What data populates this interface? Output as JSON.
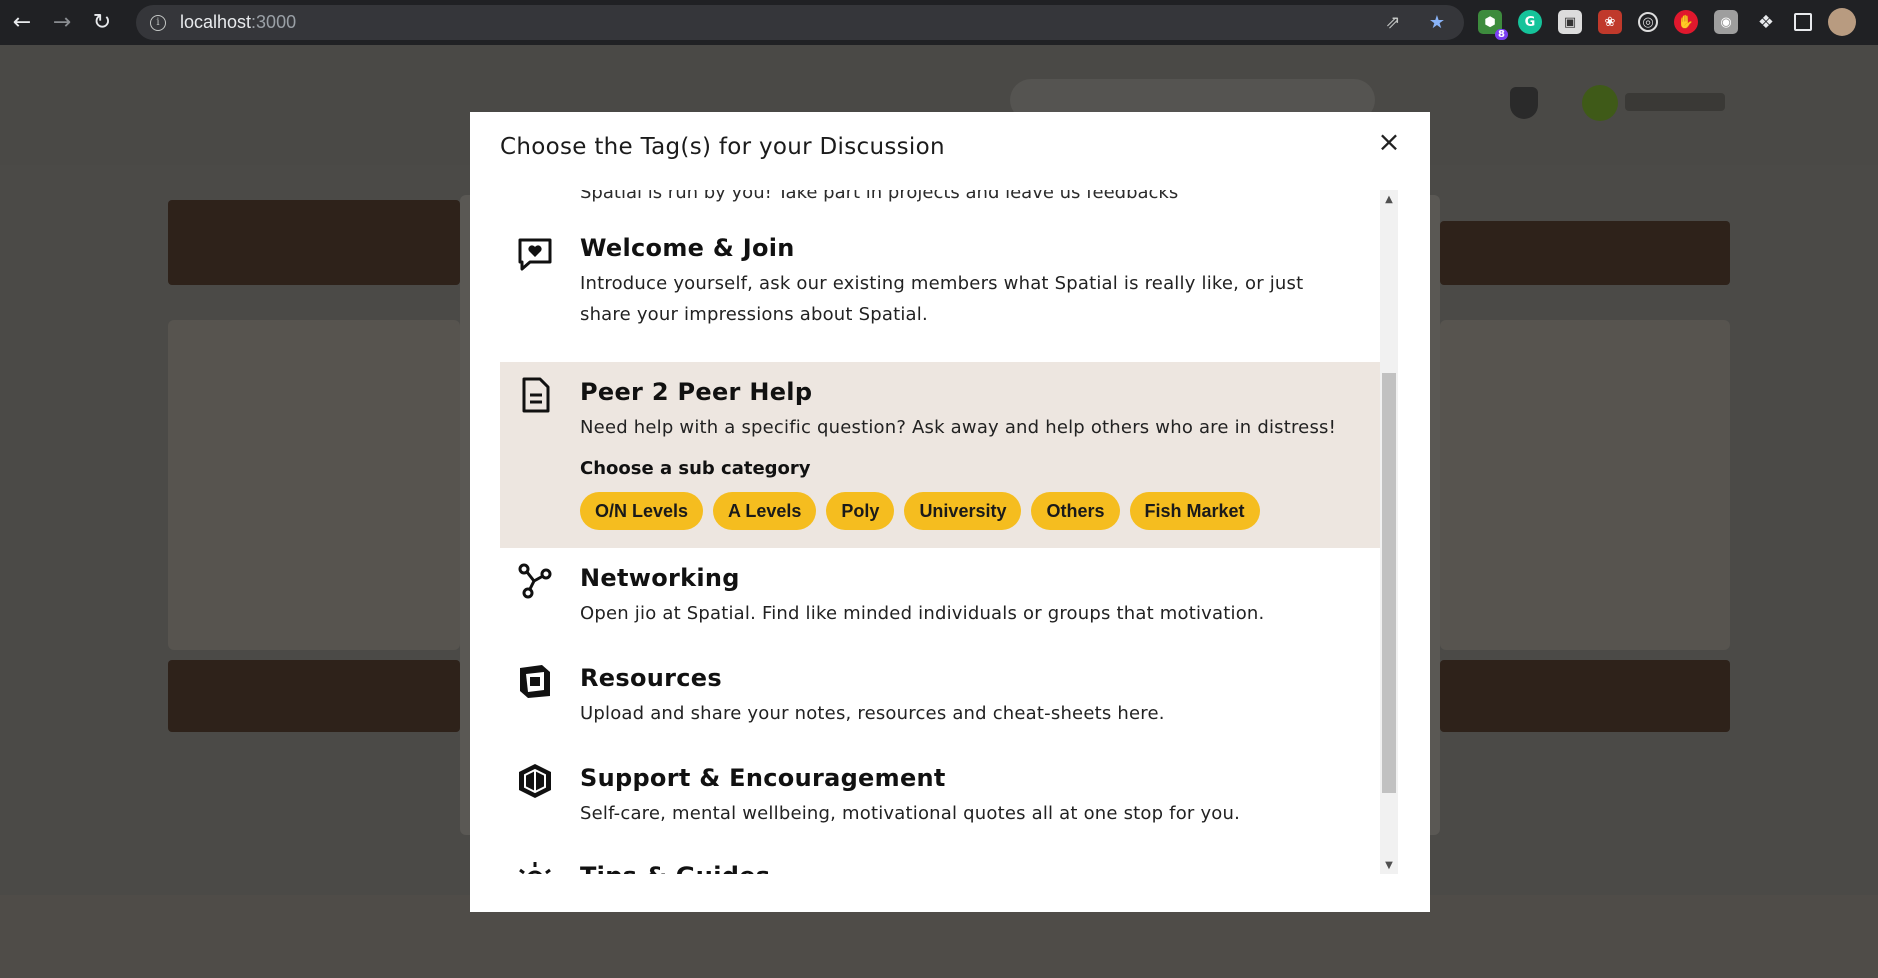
{
  "browser": {
    "url_host": "localhost",
    "url_port": ":3000",
    "extension_badge": "8"
  },
  "modal": {
    "title": "Choose the Tag(s) for your Discussion",
    "close_label": "×",
    "partial_top_text": "Spatial is run by you! Take part in projects and leave us feedbacks",
    "categories": [
      {
        "title": "Welcome & Join",
        "description": "Introduce yourself, ask our existing members what Spatial is really like, or just share your impressions about Spatial."
      },
      {
        "title": "Peer 2 Peer Help",
        "description": "Need help with a specific question? Ask away and help others who are in distress!",
        "sub_label": "Choose a sub category",
        "sub_categories": [
          "O/N Levels",
          "A Levels",
          "Poly",
          "University",
          "Others",
          "Fish Market"
        ]
      },
      {
        "title": "Networking",
        "description": "Open jio at Spatial. Find like minded individuals or groups that motivation."
      },
      {
        "title": "Resources",
        "description": "Upload and share your notes, resources and cheat-sheets here."
      },
      {
        "title": "Support & Encouragement",
        "description": "Self-care, mental wellbeing, motivational quotes all at one stop for you."
      },
      {
        "title": "Tips & Guides"
      }
    ]
  },
  "colors": {
    "chip": "#f5bd1f",
    "active_row": "#ede6e0"
  }
}
